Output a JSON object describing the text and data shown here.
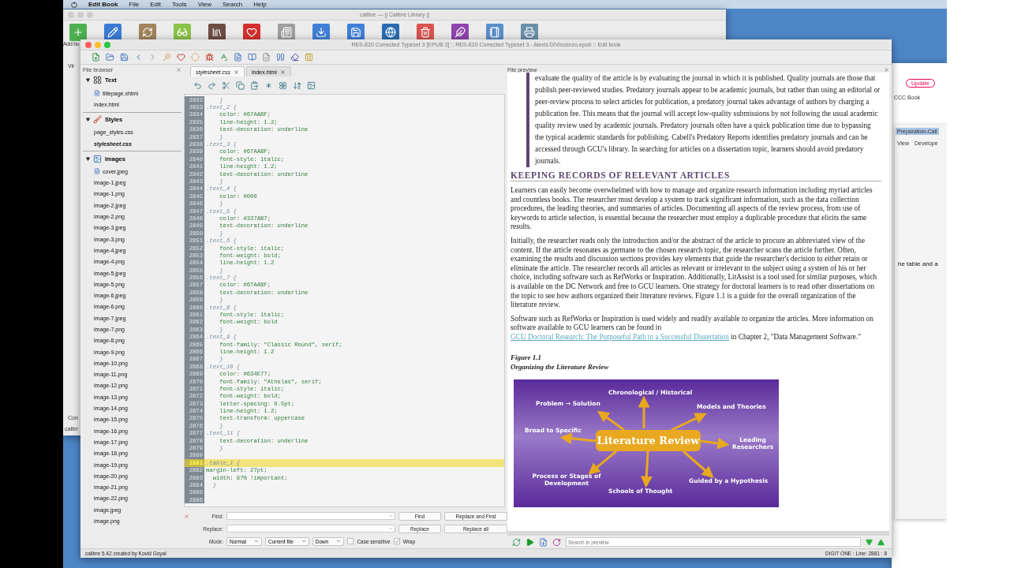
{
  "menu_bar": {
    "app": "Edit Book",
    "items": [
      "File",
      "Edit",
      "Tools",
      "View",
      "Search",
      "Help"
    ]
  },
  "library_window": {
    "title": "calibre — || Calibre Library ||",
    "toolbar_label": "Add bo",
    "side_labels": [
      "Vir",
      "Con",
      "calibr"
    ]
  },
  "editor_window": {
    "title": "RES-820 Corrected Typeset 3 [EPUB 3] :: RES-820 Corrected Typeset 3 - Alexis DiVincenzo.epub :: Edit book",
    "file_browser": {
      "title": "File browser",
      "sections": [
        {
          "label": "Text",
          "kind": "text",
          "expanded": true,
          "children": [
            {
              "label": "titlepage.xhtml",
              "icon": true,
              "open": false
            },
            {
              "label": "index.html",
              "icon": false,
              "open": false
            }
          ]
        },
        {
          "label": "Styles",
          "kind": "styles",
          "expanded": true,
          "children": [
            {
              "label": "page_styles.css",
              "icon": false,
              "open": false
            },
            {
              "label": "stylesheet.css",
              "icon": false,
              "open": true
            }
          ]
        },
        {
          "label": "Images",
          "kind": "images",
          "expanded": true,
          "children": [
            {
              "label": "cover.jpeg",
              "icon": true,
              "open": false
            },
            {
              "label": "image-1.jpeg",
              "icon": false,
              "open": false
            },
            {
              "label": "image-1.png",
              "icon": false,
              "open": false
            },
            {
              "label": "image-2.jpeg",
              "icon": false,
              "open": false
            },
            {
              "label": "image-2.png",
              "icon": false,
              "open": false
            },
            {
              "label": "image-3.jpeg",
              "icon": false,
              "open": false
            },
            {
              "label": "image-3.png",
              "icon": false,
              "open": false
            },
            {
              "label": "image-4.jpeg",
              "icon": false,
              "open": false
            },
            {
              "label": "image-4.png",
              "icon": false,
              "open": false
            },
            {
              "label": "image-5.jpeg",
              "icon": false,
              "open": false
            },
            {
              "label": "image-5.png",
              "icon": false,
              "open": false
            },
            {
              "label": "image-6.jpeg",
              "icon": false,
              "open": false
            },
            {
              "label": "image-6.png",
              "icon": false,
              "open": false
            },
            {
              "label": "image-7.jpeg",
              "icon": false,
              "open": false
            },
            {
              "label": "image-7.png",
              "icon": false,
              "open": false
            },
            {
              "label": "image-8.png",
              "icon": false,
              "open": false
            },
            {
              "label": "image-9.png",
              "icon": false,
              "open": false
            },
            {
              "label": "image-10.png",
              "icon": false,
              "open": false
            },
            {
              "label": "image-11.png",
              "icon": false,
              "open": false
            },
            {
              "label": "image-12.png",
              "icon": false,
              "open": false
            },
            {
              "label": "image-13.png",
              "icon": false,
              "open": false
            },
            {
              "label": "image-14.png",
              "icon": false,
              "open": false
            },
            {
              "label": "image-15.png",
              "icon": false,
              "open": false
            },
            {
              "label": "image-16.png",
              "icon": false,
              "open": false
            },
            {
              "label": "image-17.png",
              "icon": false,
              "open": false
            },
            {
              "label": "image-18.png",
              "icon": false,
              "open": false
            },
            {
              "label": "image-19.png",
              "icon": false,
              "open": false
            },
            {
              "label": "image-20.png",
              "icon": false,
              "open": false
            },
            {
              "label": "image-21.png",
              "icon": false,
              "open": false
            },
            {
              "label": "image-22.png",
              "icon": false,
              "open": false
            },
            {
              "label": "image.jpeg",
              "icon": false,
              "open": false
            },
            {
              "label": "image.png",
              "icon": false,
              "open": false
            }
          ]
        }
      ]
    },
    "editor": {
      "tabs": [
        {
          "label": "stylesheet.css",
          "selected": true
        },
        {
          "label": "index.html",
          "selected": false
        }
      ],
      "lines": [
        {
          "number": "2832",
          "kind": "brace",
          "text": "    }",
          "current": false
        },
        {
          "number": "2833",
          "kind": "selector",
          "text": ".text_2 {",
          "current": false
        },
        {
          "number": "2834",
          "kind": "declaration",
          "property": "    color:",
          "value": " #67AABF;",
          "current": false
        },
        {
          "number": "2835",
          "kind": "declaration",
          "property": "    line-height:",
          "value": " 1.2;",
          "current": false
        },
        {
          "number": "2836",
          "kind": "declaration",
          "property": "    text-decoration:",
          "value": " underline",
          "current": false
        },
        {
          "number": "2837",
          "kind": "brace",
          "text": "    }",
          "current": false
        },
        {
          "number": "2838",
          "kind": "selector",
          "text": ".text_3 {",
          "current": false
        },
        {
          "number": "2839",
          "kind": "declaration",
          "property": "    color:",
          "value": " #67AABF;",
          "current": false
        },
        {
          "number": "2840",
          "kind": "declaration",
          "property": "    font-style:",
          "value": " italic;",
          "current": false
        },
        {
          "number": "2841",
          "kind": "declaration",
          "property": "    line-height:",
          "value": " 1.2;",
          "current": false
        },
        {
          "number": "2842",
          "kind": "declaration",
          "property": "    text-decoration:",
          "value": " underline",
          "current": false
        },
        {
          "number": "2843",
          "kind": "brace",
          "text": "    }",
          "current": false
        },
        {
          "number": "2844",
          "kind": "selector",
          "text": ".text_4 {",
          "current": false
        },
        {
          "number": "2845",
          "kind": "declaration",
          "property": "    color:",
          "value": " #000",
          "current": false
        },
        {
          "number": "2846",
          "kind": "brace",
          "text": "    }",
          "current": false
        },
        {
          "number": "2847",
          "kind": "selector",
          "text": ".text_5 {",
          "current": false
        },
        {
          "number": "2848",
          "kind": "declaration",
          "property": "    color:",
          "value": " #337AB7;",
          "current": false
        },
        {
          "number": "2849",
          "kind": "declaration",
          "property": "    text-decoration:",
          "value": " underline",
          "current": false
        },
        {
          "number": "2850",
          "kind": "brace",
          "text": "    }",
          "current": false
        },
        {
          "number": "2851",
          "kind": "selector",
          "text": ".text_6 {",
          "current": false
        },
        {
          "number": "2852",
          "kind": "declaration",
          "property": "    font-style:",
          "value": " italic;",
          "current": false
        },
        {
          "number": "2853",
          "kind": "declaration",
          "property": "    font-weight:",
          "value": " bold;",
          "current": false
        },
        {
          "number": "2854",
          "kind": "declaration",
          "property": "    line-height:",
          "value": " 1.2",
          "current": false
        },
        {
          "number": "2855",
          "kind": "brace",
          "text": "    }",
          "current": false
        },
        {
          "number": "2856",
          "kind": "selector",
          "text": ".text_7 {",
          "current": false
        },
        {
          "number": "2857",
          "kind": "declaration",
          "property": "    color:",
          "value": " #67AABF;",
          "current": false
        },
        {
          "number": "2858",
          "kind": "declaration",
          "property": "    text-decoration:",
          "value": " underline",
          "current": false
        },
        {
          "number": "2859",
          "kind": "brace",
          "text": "    }",
          "current": false
        },
        {
          "number": "2860",
          "kind": "selector",
          "text": ".text_8 {",
          "current": false
        },
        {
          "number": "2861",
          "kind": "declaration",
          "property": "    font-style:",
          "value": " italic;",
          "current": false
        },
        {
          "number": "2862",
          "kind": "declaration",
          "property": "    font-weight:",
          "value": " bold",
          "current": false
        },
        {
          "number": "2863",
          "kind": "brace",
          "text": "    }",
          "current": false
        },
        {
          "number": "2864",
          "kind": "selector",
          "text": ".text_9 {",
          "current": false
        },
        {
          "number": "2865",
          "kind": "declaration",
          "property": "    font-family:",
          "value": " \"Classic Round\", serif;",
          "current": false
        },
        {
          "number": "2866",
          "kind": "declaration",
          "property": "    line-height:",
          "value": " 1.2",
          "current": false
        },
        {
          "number": "2867",
          "kind": "brace",
          "text": "    }",
          "current": false
        },
        {
          "number": "2868",
          "kind": "selector",
          "text": ".text_10 {",
          "current": false
        },
        {
          "number": "2869",
          "kind": "declaration",
          "property": "    color:",
          "value": " #634E77;",
          "current": false
        },
        {
          "number": "2870",
          "kind": "declaration",
          "property": "    font-family:",
          "value": " \"Athelas\", serif;",
          "current": false
        },
        {
          "number": "2871",
          "kind": "declaration",
          "property": "    font-style:",
          "value": " italic;",
          "current": false
        },
        {
          "number": "2872",
          "kind": "declaration",
          "property": "    font-weight:",
          "value": " bold;",
          "current": false
        },
        {
          "number": "2873",
          "kind": "declaration",
          "property": "    letter-spacing:",
          "value": " 0.5pt;",
          "current": false
        },
        {
          "number": "2874",
          "kind": "declaration",
          "property": "    line-height:",
          "value": " 1.2;",
          "current": false
        },
        {
          "number": "2875",
          "kind": "declaration",
          "property": "    text-transform:",
          "value": " uppercase",
          "current": false
        },
        {
          "number": "2876",
          "kind": "brace",
          "text": "    }",
          "current": false
        },
        {
          "number": "2877",
          "kind": "selector",
          "text": ".text_11 {",
          "current": false
        },
        {
          "number": "2878",
          "kind": "declaration",
          "property": "    text-decoration:",
          "value": " underline",
          "current": false
        },
        {
          "number": "2879",
          "kind": "brace",
          "text": "    }",
          "current": false
        },
        {
          "number": "2880",
          "kind": "blank",
          "current": false
        },
        {
          "number": "2881",
          "kind": "selector",
          "text": ".table_1 {",
          "current": true
        },
        {
          "number": "2882",
          "kind": "declaration",
          "property": "margin-left:",
          "value": " 27pt;",
          "current": false
        },
        {
          "number": "2883",
          "kind": "declaration",
          "property": "  width:",
          "value": " 97% !important;",
          "current": false
        },
        {
          "number": "2884",
          "kind": "brace",
          "text": "  }",
          "current": false
        },
        {
          "number": "2885",
          "kind": "blank",
          "current": false
        },
        {
          "number": "2886",
          "kind": "blank",
          "current": false
        }
      ]
    },
    "find_bar": {
      "find_label": "Find:",
      "replace_label": "Replace:",
      "mode_label": "Mode:",
      "buttons": [
        "Find",
        "Replace and Find",
        "Replace",
        "Replace all"
      ],
      "selects": [
        "Normal",
        "Current file",
        "Down"
      ],
      "options": [
        {
          "label": "Case sensitive",
          "checked": false
        },
        {
          "label": "Wrap",
          "checked": true
        }
      ]
    },
    "preview": {
      "title": "File preview",
      "quote": "evaluate the quality of the article is by evaluating the journal in which it is published. Quality journals are those that publish peer-reviewed studies. Predatory journals appear to be academic journals, but rather than using an editorial or peer-review process to select articles for publication, a predatory journal takes advantage of authors by charging a publication fee. This means that the journal will accept low-quality submissions by not following the usual academic quality review used by academic journals. Predatory journals often have a quick publication time due to bypassing the typical academic standards for publishing. Cabell's Predatory Reports identifies predatory journals and can be accessed through GCU's library. In searching for articles on a dissertation topic, learners should avoid predatory journals.",
      "heading": "KEEPING RECORDS OF RELEVANT ARTICLES",
      "paragraphs": [
        "Learners can easily become overwhelmed with how to manage and organize research information including myriad articles and countless books. The researcher must develop a system to track significant information, such as the data collection procedures, the leading theories, and summaries of articles. Documenting all aspects of the review process, from use of keywords to article selection, is essential because the researcher must employ a duplicable procedure that elicits the same results.",
        "Initially, the researcher reads only the introduction and/or the abstract of the article to procure an abbreviated view of the content. If the article resonates as germane to the chosen research topic, the researcher scans the article further. Often, examining the results and discussion sections provides key elements that guide the researcher's decision to either retain or eliminate the article. The researcher records all articles as relevant or irrelevant to the subject using a system of his or her choice, including software such as RefWorks or Inspiration. Additionally, LitAssist is a tool used for similar purposes, which is available on the DC Network and free to GCU learners. One strategy for doctoral learners is to read other dissertations on the topic to see how authors organized their literature reviews. Figure 1.1 is a guide for the overall organization of the literature review."
      ],
      "link_paragraph": {
        "before": "Software such as RefWorks or Inspiration is used widely and readily available to organize the articles. More information on software available to GCU learners can be found in ",
        "link": "GCU Doctoral Research: The Purposeful Path to a Successful Dissertation",
        "after": " in Chapter 2, \"Data Management Software.\""
      },
      "figure": {
        "number": "Figure 1.1",
        "title": "Organizing the Literature Review",
        "center": "Literature Review",
        "labels": [
          "Chronological / Historical",
          "Problem → Solution",
          "Models and Theories",
          "Broad to Specific",
          "Leading Researchers",
          "Process or Stages of Development",
          "Guided by a Hypothesis",
          "Schools of Thought"
        ]
      },
      "search_placeholder": "Search in preview"
    },
    "status_bar": {
      "left": "calibre 5.42 created by Kovid Goyal",
      "right": "DIGIT ONE : Line: 2881 : 8"
    }
  },
  "other_window": {
    "button": "Update",
    "label": "CCC Book",
    "tab": "Preparation-Call",
    "menu": [
      "View",
      "Develope"
    ],
    "text": "he table and a"
  }
}
